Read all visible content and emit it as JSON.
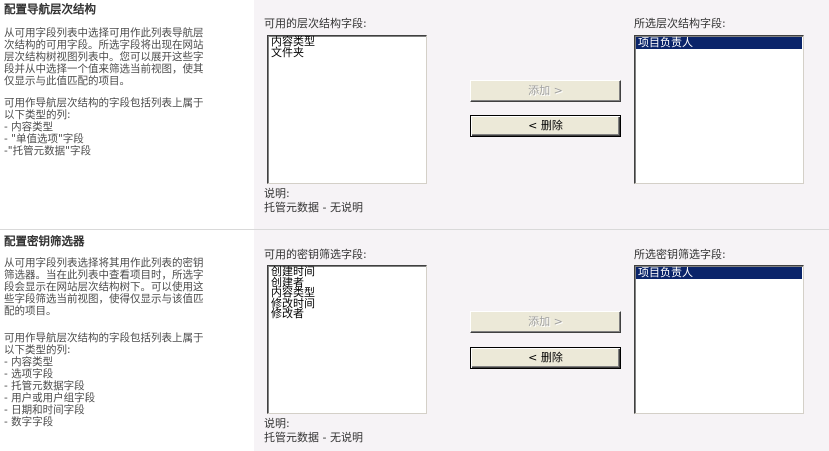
{
  "nav": {
    "title": "配置导航层次结构",
    "desc_lines": [
      "从可用字段列表中选择可用作此列表导航层",
      "次结构的可用字段。所选字段将出现在网站",
      "层次结构树视图列表中。您可以展开这些字",
      "段并从中选择一个值来筛选当前视图，使其",
      "仅显示与此值匹配的项目。"
    ],
    "desc2_lines": [
      "可用作导航层次结构的字段包括列表上属于",
      "以下类型的列:"
    ],
    "types": [
      "- 内容类型",
      "- \"单值选项\"字段",
      "-\"托管元数据\"字段"
    ],
    "available_label": "可用的层次结构字段:",
    "available": [
      "内容类型",
      "文件夹"
    ],
    "add_button": "添加 >",
    "remove_button": "< 删除",
    "selected_label": "所选层次结构字段:",
    "selected": [
      "项目负责人"
    ],
    "note_label": "说明:",
    "note_text": "托管元数据 - 无说明"
  },
  "key": {
    "title": "配置密钥筛选器",
    "desc_lines": [
      "从可用字段列表选择将其用作此列表的密钥",
      "筛选器。当在此列表中查看项目时，所选字",
      "段会显示在网站层次结构树下。可以使用这",
      "些字段筛选当前视图，使得仅显示与该值匹",
      "配的项目。"
    ],
    "desc2_lines": [
      "可用作导航层次结构的字段包括列表上属于",
      "以下类型的列:"
    ],
    "types": [
      "- 内容类型",
      "- 选项字段",
      "- 托管元数据字段",
      "- 用户或用户组字段",
      "- 日期和时间字段",
      "- 数字字段"
    ],
    "available_label": "可用的密钥筛选字段:",
    "available": [
      "创建时间",
      "创建者",
      "内容类型",
      "修改时间",
      "修改者"
    ],
    "add_button": "添加 >",
    "remove_button": "< 删除",
    "selected_label": "所选密钥筛选字段:",
    "selected": [
      "项目负责人"
    ],
    "note_label": "说明:",
    "note_text": "托管元数据 - 无说明"
  }
}
